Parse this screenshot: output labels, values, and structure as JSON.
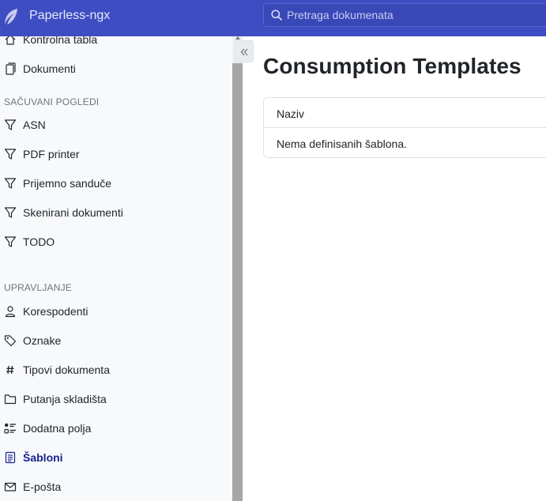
{
  "app": {
    "title": "Paperless-ngx"
  },
  "search": {
    "placeholder": "Pretraga dokumenata"
  },
  "sidebar": {
    "top_items": [
      {
        "label": "Kontrolna tabla",
        "icon": "house-icon"
      },
      {
        "label": "Dokumenti",
        "icon": "documents-icon"
      }
    ],
    "saved_views_heading": "SAČUVANI POGLEDI",
    "saved_views": [
      {
        "label": "ASN",
        "icon": "funnel-icon"
      },
      {
        "label": "PDF printer",
        "icon": "funnel-icon"
      },
      {
        "label": "Prijemno sanduče",
        "icon": "funnel-icon"
      },
      {
        "label": "Skenirani dokumenti",
        "icon": "funnel-icon"
      },
      {
        "label": "TODO",
        "icon": "funnel-icon"
      }
    ],
    "manage_heading": "UPRAVLJANJE",
    "manage": [
      {
        "label": "Korespodenti",
        "icon": "person-icon"
      },
      {
        "label": "Oznake",
        "icon": "tags-icon"
      },
      {
        "label": "Tipovi dokumenta",
        "icon": "hash-icon"
      },
      {
        "label": "Putanja skladišta",
        "icon": "folder-icon"
      },
      {
        "label": "Dodatna polja",
        "icon": "ui-radios-icon"
      },
      {
        "label": "Šabloni",
        "icon": "template-icon",
        "active": true
      },
      {
        "label": "E-pošta",
        "icon": "envelope-icon"
      }
    ]
  },
  "main": {
    "title": "Consumption Templates",
    "table": {
      "header": "Naziv",
      "empty_message": "Nema definisanih šablona."
    }
  },
  "colors": {
    "navbar": "#3e4ec2",
    "sidebar_bg": "#f8f9fa",
    "active_link": "#17238f"
  }
}
